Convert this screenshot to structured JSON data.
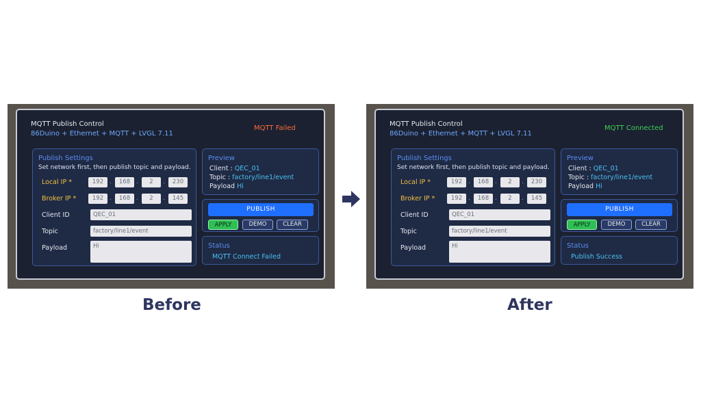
{
  "panels": [
    {
      "id": "before",
      "app_title": "MQTT Publish Control",
      "subtitle": "86Duino + Ethernet + MQTT + LVGL 7.11",
      "status_top": "MQTT Failed",
      "status_top_color": "#ff6a3d",
      "publish_settings": {
        "heading": "Publish Settings",
        "hint": "Set network first, then publish topic and payload.",
        "local_ip_label": "Local IP *",
        "local_ip": [
          "192",
          "168",
          "2",
          "230"
        ],
        "broker_ip_label": "Broker IP *",
        "broker_ip": [
          "192",
          "168",
          "2",
          "145"
        ],
        "client_id_label": "Client ID",
        "client_id_value": "QEC_01",
        "topic_label": "Topic",
        "topic_value": "factory/line1/event",
        "payload_label": "Payload",
        "payload_value": "Hi"
      },
      "preview": {
        "heading": "Preview",
        "client_label": "Client :",
        "client_value": "QEC_01",
        "topic_label": "Topic :",
        "topic_value": "factory/line1/event",
        "payload_label": "Payload",
        "payload_value": "Hi"
      },
      "buttons": {
        "publish": "PUBLISH",
        "apply": "APPLY",
        "demo": "DEMO",
        "clear": "CLEAR"
      },
      "status": {
        "heading": "Status",
        "text": "MQTT Connect Failed"
      }
    },
    {
      "id": "after",
      "app_title": "MQTT Publish Control",
      "subtitle": "86Duino + Ethernet + MQTT + LVGL 7.11",
      "status_top": "MQTT Connected",
      "status_top_color": "#3fd05a",
      "publish_settings": {
        "heading": "Publish Settings",
        "hint": "Set network first, then publish topic and payload.",
        "local_ip_label": "Local IP *",
        "local_ip": [
          "192",
          "168",
          "2",
          "230"
        ],
        "broker_ip_label": "Broker IP *",
        "broker_ip": [
          "192",
          "168",
          "2",
          "145"
        ],
        "client_id_label": "Client ID",
        "client_id_value": "QEC_01",
        "topic_label": "Topic",
        "topic_value": "factory/line1/event",
        "payload_label": "Payload",
        "payload_value": "Hi"
      },
      "preview": {
        "heading": "Preview",
        "client_label": "Client :",
        "client_value": "QEC_01",
        "topic_label": "Topic :",
        "topic_value": "factory/line1/event",
        "payload_label": "Payload",
        "payload_value": "Hi"
      },
      "buttons": {
        "publish": "PUBLISH",
        "apply": "APPLY",
        "demo": "DEMO",
        "clear": "CLEAR"
      },
      "status": {
        "heading": "Status",
        "text": "Publish Success"
      }
    }
  ],
  "captions": {
    "before": "Before",
    "after": "After"
  },
  "arrow_icon": "arrow-right-icon",
  "colors": {
    "caption": "#2e3560",
    "accent": "#1f6fff"
  }
}
